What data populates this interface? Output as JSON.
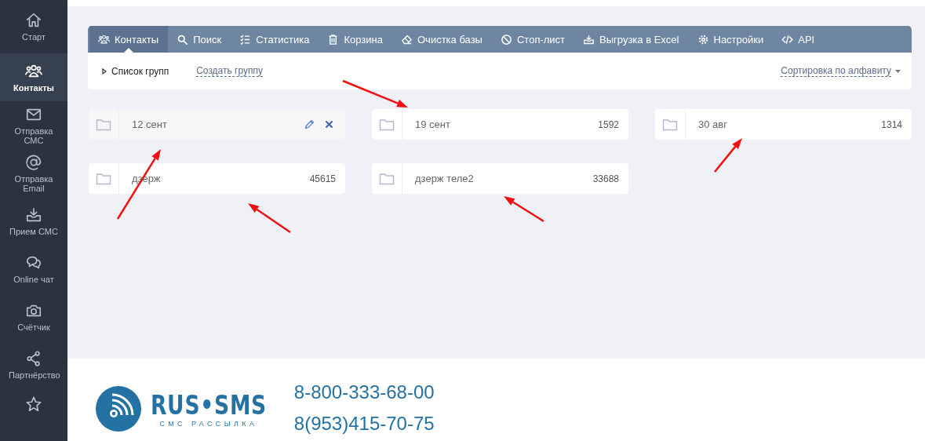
{
  "sidebar": {
    "items": [
      {
        "label": "Старт",
        "selected": false
      },
      {
        "label": "Контакты",
        "selected": true
      },
      {
        "label": "Отправка СМС",
        "selected": false
      },
      {
        "label": "Отправка Email",
        "selected": false
      },
      {
        "label": "Прием СМС",
        "selected": false
      },
      {
        "label": "Online чат",
        "selected": false
      },
      {
        "label": "Счётчик",
        "selected": false
      },
      {
        "label": "Партнёрство",
        "selected": false
      },
      {
        "selected": false
      }
    ]
  },
  "tabs": [
    {
      "label": "Контакты",
      "selected": true
    },
    {
      "label": "Поиск",
      "selected": false
    },
    {
      "label": "Статистика",
      "selected": false
    },
    {
      "label": "Корзина",
      "selected": false
    },
    {
      "label": "Очистка базы",
      "selected": false
    },
    {
      "label": "Стоп-лист",
      "selected": false
    },
    {
      "label": "Выгрузка в Excel",
      "selected": false
    },
    {
      "label": "Настройки",
      "selected": false
    },
    {
      "label": "API",
      "selected": false
    }
  ],
  "subbar": {
    "list_label": "Список групп",
    "create_link": "Создать группу",
    "sort_link": "Сортировка по алфавиту"
  },
  "groups": [
    {
      "name": "12 сент",
      "hovered": true
    },
    {
      "name": "19 сент",
      "count": "1592",
      "hovered": false
    },
    {
      "name": "30 авг",
      "count": "1314",
      "hovered": false
    },
    {
      "name": "дзерж",
      "count": "45615",
      "hovered": false
    },
    {
      "name": "дзерж теле2",
      "count": "33688",
      "hovered": false
    }
  ],
  "footer": {
    "logo_title": "RUS•SMS",
    "logo_subtitle": "СМС РАССЫЛКА",
    "phones": [
      "8-800-333-68-00",
      "8(953)415-70-75"
    ]
  }
}
